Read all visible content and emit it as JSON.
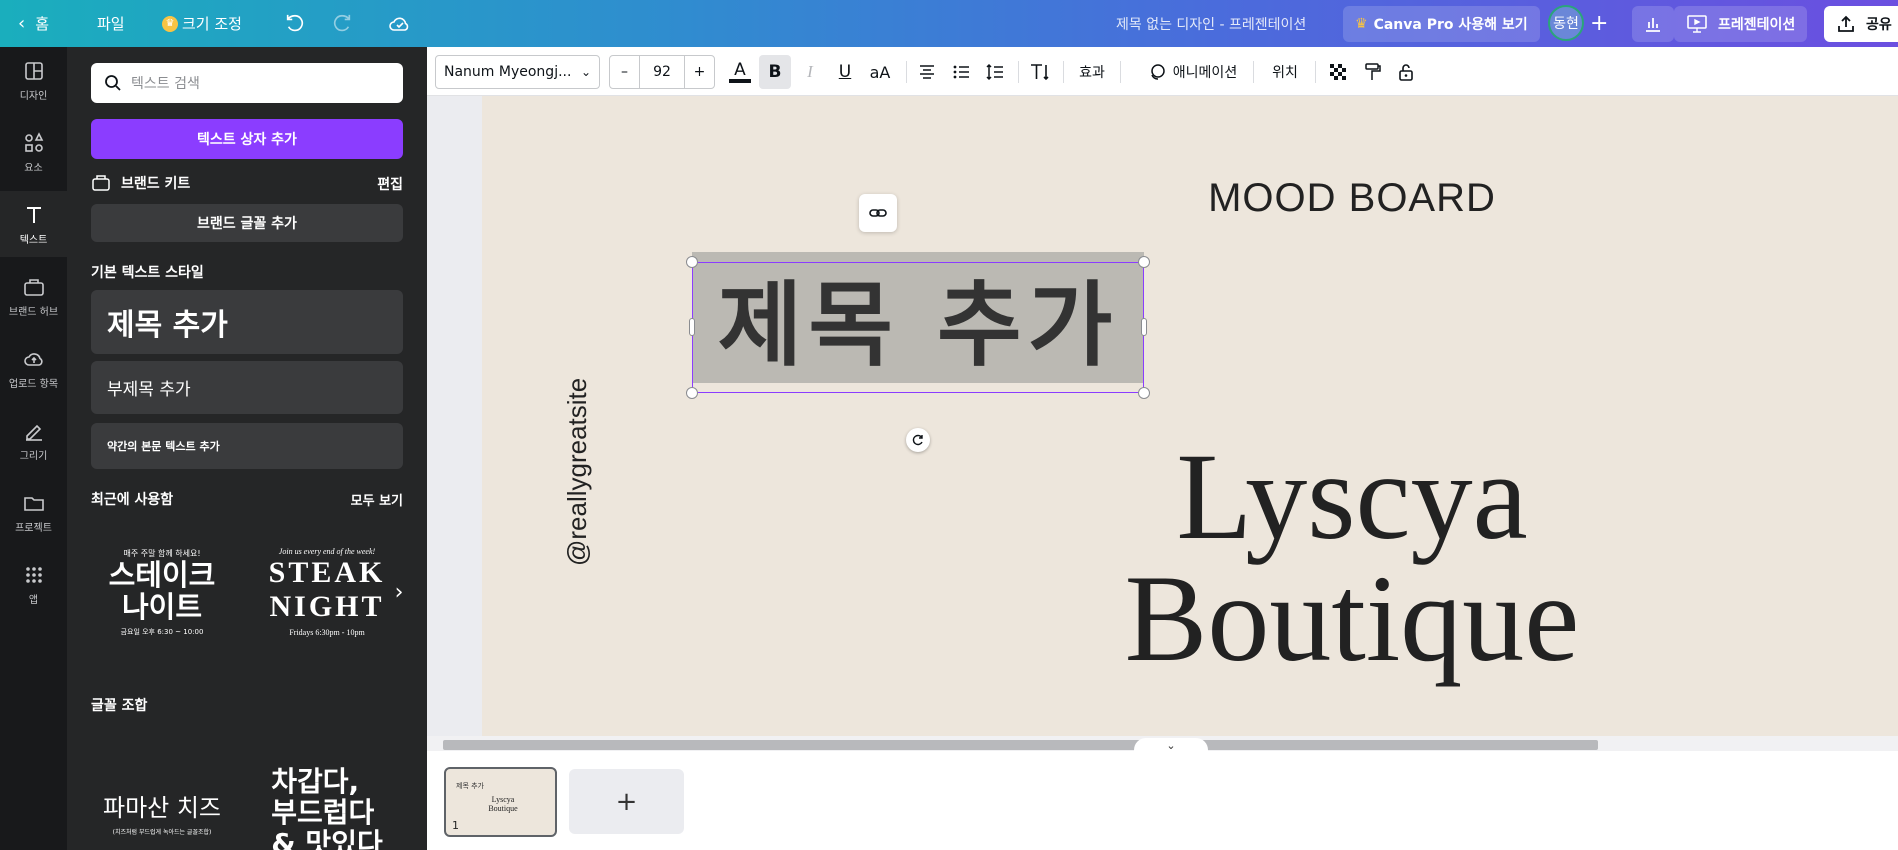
{
  "topbar": {
    "back_label": "홈",
    "file_label": "파일",
    "resize_label": "크기 조정",
    "doc_title": "제목 없는 디자인 - 프레젠테이션",
    "pro_label": "Canva Pro 사용해 보기",
    "avatar_text": "동현",
    "present_label": "프레젠테이션",
    "share_label": "공유",
    "gradient_start": "#1aaebd",
    "gradient_end": "#6b4fe0"
  },
  "rail": {
    "items": [
      {
        "label": "디자인",
        "icon": "layout-icon"
      },
      {
        "label": "요소",
        "icon": "shapes-icon"
      },
      {
        "label": "텍스트",
        "icon": "text-icon"
      },
      {
        "label": "브랜드 허브",
        "icon": "brand-hub-icon"
      },
      {
        "label": "업로드 항목",
        "icon": "upload-cloud-icon"
      },
      {
        "label": "그리기",
        "icon": "draw-pen-icon"
      },
      {
        "label": "프로젝트",
        "icon": "folder-icon"
      },
      {
        "label": "앱",
        "icon": "apps-grid-icon"
      }
    ]
  },
  "panel": {
    "search_placeholder": "텍스트 검색",
    "add_textbox_label": "텍스트 상자 추가",
    "brand_kit_label": "브랜드 키트",
    "brand_kit_edit": "편집",
    "add_brand_font_label": "브랜드 글꼴 추가",
    "default_styles_title": "기본 텍스트 스타일",
    "style_heading": "제목 추가",
    "style_subheading": "부제목 추가",
    "style_body": "약간의 본문 텍스트 추가",
    "recent_title": "최근에 사용함",
    "see_all": "모두 보기",
    "recent_items": [
      {
        "top": "매주 주말 함께 하세요!",
        "main": "스테이크\n나이트",
        "bottom": "금요일 오후 6:30 ~ 10:00"
      },
      {
        "top": "Join us every end of the week!",
        "main": "STEAK\nNIGHT",
        "bottom": "Fridays 6:30pm - 10pm"
      }
    ],
    "combos_title": "글꼴 조합",
    "combo_items": [
      {
        "main": "파마산 치즈",
        "sub": "(치즈처럼 부드럽게 녹아드는 글꼴조합)"
      },
      {
        "main": "차갑다,\n부드럽다\n& 맛있다"
      }
    ],
    "accent_color": "#8b3dff"
  },
  "toolbar": {
    "font_name": "Nanum Myeongj...",
    "font_size": "92",
    "size_minus": "–",
    "size_plus": "+",
    "bold_label": "B",
    "italic_label": "I",
    "underline_label": "U",
    "case_label": "aA",
    "effects_label": "효과",
    "animate_label": "애니메이션",
    "position_label": "위치"
  },
  "canvas": {
    "mood_board": "MOOD BOARD",
    "title_text": "제목 추가",
    "website": "@reallygreatsite",
    "brand_line1": "Lyscya",
    "brand_line2": "Boutique",
    "background_color": "#ede6dc"
  },
  "pages": {
    "current_page_number": "1",
    "thumb_title": "제목 추가",
    "thumb_brand": "Lyscya\nBoutique",
    "add_page_label": "+"
  }
}
